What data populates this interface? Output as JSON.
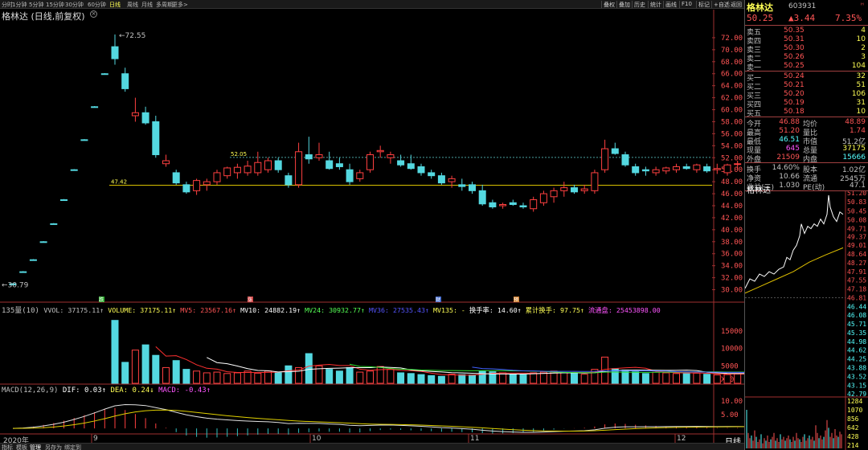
{
  "toolbar": {
    "periods": [
      "分时",
      "1分钟",
      "5分钟",
      "15分钟",
      "30分钟",
      "60分钟",
      "日线",
      "周线",
      "月线",
      "多周期",
      "更多>"
    ],
    "active_period": "日线",
    "right_buttons": [
      "叠权",
      "叠加",
      "历史",
      "统计",
      "画线",
      "F10",
      "标记",
      "+自选",
      "返回"
    ]
  },
  "chart": {
    "title": "格林达 (日线,前复权)",
    "high_marker": "72.55",
    "low_marker": "30.79",
    "line1_label": "52.05",
    "line2_label": "47.42",
    "price_axis": [
      "72.00",
      "70.00",
      "68.00",
      "66.00",
      "64.00",
      "62.00",
      "60.00",
      "58.00",
      "56.00",
      "54.00",
      "52.00",
      "50.00",
      "48.00",
      "46.00",
      "44.00",
      "42.00",
      "40.00",
      "38.00",
      "36.00",
      "34.00",
      "32.00",
      "30.00"
    ],
    "event_markers": [
      "跌",
      "涨",
      "财",
      "预"
    ],
    "vol_axis": [
      "15000",
      "10000",
      "5000",
      "X10"
    ],
    "macd_axis": [
      "10.00",
      "5.00"
    ],
    "date_labels": [
      "2020年",
      "9",
      "10",
      "11",
      "12"
    ],
    "period_label": "日线"
  },
  "volume_line": {
    "label": "135量(10)",
    "items": [
      {
        "text": "VVOL: 37175.11↑",
        "color": "#c0c0c0"
      },
      {
        "text": "VOLUME: 37175.11↑",
        "color": "#ffff55"
      },
      {
        "text": "MV5: 23567.16↑",
        "color": "#ff5555"
      },
      {
        "text": "MV10: 24882.19↑",
        "color": "#ffffff"
      },
      {
        "text": "MV24: 30932.77↑",
        "color": "#55ff55"
      },
      {
        "text": "MV36: 27535.43↑",
        "color": "#5555ff"
      },
      {
        "text": "MV135: -",
        "color": "#ffff55"
      },
      {
        "text": "换手率: 14.60↑",
        "color": "#ffffff"
      },
      {
        "text": "累计换手: 97.75↑",
        "color": "#ffff55"
      },
      {
        "text": "流通盘: 25453898.00",
        "color": "#ff55ff"
      }
    ]
  },
  "macd_line": {
    "items": [
      {
        "text": "MACD(12,26,9)",
        "color": "#c0c0c0"
      },
      {
        "text": "DIF: 0.03↑",
        "color": "#ffffff"
      },
      {
        "text": "DEA: 0.24↓",
        "color": "#ffff55"
      },
      {
        "text": "MACD: -0.43↑",
        "color": "#ff55ff"
      }
    ]
  },
  "quote": {
    "name": "格林达",
    "code": "603931",
    "price": "50.25",
    "change": "▲3.44",
    "pct": "7.35%",
    "asks": [
      {
        "label": "卖五",
        "price": "50.35",
        "vol": "4"
      },
      {
        "label": "卖四",
        "price": "50.31",
        "vol": "10"
      },
      {
        "label": "卖三",
        "price": "50.30",
        "vol": "2"
      },
      {
        "label": "卖二",
        "price": "50.26",
        "vol": "3"
      },
      {
        "label": "卖一",
        "price": "50.25",
        "vol": "104"
      }
    ],
    "bids": [
      {
        "label": "买一",
        "price": "50.24",
        "vol": "32"
      },
      {
        "label": "买二",
        "price": "50.21",
        "vol": "51"
      },
      {
        "label": "买三",
        "price": "50.20",
        "vol": "106"
      },
      {
        "label": "买四",
        "price": "50.19",
        "vol": "31"
      },
      {
        "label": "买五",
        "price": "50.18",
        "vol": "10"
      }
    ],
    "stats1": [
      {
        "l1": "今开",
        "v1": "46.88",
        "l2": "均价",
        "v2": "48.89"
      },
      {
        "l1": "最高",
        "v1": "51.20",
        "l2": "量比",
        "v2": "1.74"
      },
      {
        "l1": "最低",
        "v1": "46.51",
        "l2": "市值",
        "v2": "51.2亿"
      },
      {
        "l1": "现量",
        "v1": "645",
        "l2": "总量",
        "v2": "37175"
      },
      {
        "l1": "外盘",
        "v1": "21509",
        "l2": "内盘",
        "v2": "15666"
      }
    ],
    "stats2": [
      {
        "l1": "换手",
        "v1": "14.60%",
        "l2": "股本",
        "v2": "1.02亿"
      },
      {
        "l1": "净资",
        "v1": "10.66",
        "l2": "流通",
        "v2": "2545万"
      },
      {
        "l1": "收益(三)",
        "v1": "1.030",
        "l2": "PE(动)",
        "v2": "47.1"
      }
    ],
    "mini_title": "格林达",
    "mini_axis": [
      "51.20",
      "50.83",
      "50.45",
      "50.08",
      "49.71",
      "49.37",
      "49.01",
      "48.64",
      "48.27",
      "47.91",
      "47.55",
      "47.18",
      "46.81",
      "46.44",
      "46.08",
      "45.71",
      "45.35",
      "44.98",
      "44.62",
      "44.25",
      "43.88",
      "43.52",
      "43.15",
      "42.79"
    ],
    "mini_vol_axis": [
      "1284",
      "1070",
      "856",
      "642",
      "428",
      "214"
    ]
  },
  "bottom_tabs": [
    "指标",
    "模板",
    "管理",
    "另存为",
    "绑定到"
  ],
  "chart_data": {
    "type": "candlestick",
    "title": "格林达 (日线,前复权)",
    "candles": [
      [
        31,
        31.1,
        30.8,
        30.8
      ],
      [
        33,
        33.1,
        32.9,
        32.9
      ],
      [
        35,
        35.1,
        34.9,
        34.9
      ],
      [
        38,
        38.1,
        37.9,
        37.9
      ],
      [
        41,
        41.1,
        40.9,
        40.9
      ],
      [
        45,
        45.1,
        44.9,
        44.9
      ],
      [
        50,
        50.1,
        49.9,
        49.9
      ],
      [
        55,
        55.1,
        54.9,
        54.9
      ],
      [
        60.5,
        60.6,
        60.4,
        60.4
      ],
      [
        66,
        66.1,
        65.9,
        65.9
      ],
      [
        70.5,
        72.55,
        67.5,
        68.5
      ],
      [
        66,
        67,
        63,
        63.5
      ],
      [
        59,
        62,
        58,
        59.5
      ],
      [
        59.5,
        60.5,
        57.5,
        57.8
      ],
      [
        58,
        59,
        52,
        52.5
      ],
      [
        51,
        52.5,
        50.5,
        51.5
      ],
      [
        49.5,
        50,
        47.5,
        47.8
      ],
      [
        47.5,
        48,
        46,
        46.3
      ],
      [
        46.5,
        48.5,
        45.8,
        48.2
      ],
      [
        47.5,
        48.5,
        46.5,
        48
      ],
      [
        48,
        50,
        47.5,
        49.5
      ],
      [
        49,
        50.5,
        48.5,
        50.3
      ],
      [
        49.5,
        51,
        48.5,
        50.4
      ],
      [
        49.5,
        51.5,
        49,
        50.6
      ],
      [
        49.5,
        53,
        49,
        51.2
      ],
      [
        50,
        52,
        49.5,
        51.5
      ],
      [
        51.5,
        52,
        49.5,
        50
      ],
      [
        49,
        49.5,
        47,
        47.5
      ],
      [
        47.5,
        54.5,
        47,
        53
      ],
      [
        52.5,
        55.5,
        51,
        51.8
      ],
      [
        52,
        54.5,
        51.5,
        52.5
      ],
      [
        51.5,
        53,
        50,
        50.2
      ],
      [
        51,
        52,
        50,
        50.5
      ],
      [
        50,
        51,
        47.5,
        48
      ],
      [
        48.5,
        50,
        48,
        49.5
      ],
      [
        50,
        53,
        49.5,
        52.5
      ],
      [
        53,
        54,
        52,
        53.2
      ],
      [
        52,
        53,
        51,
        52.5
      ],
      [
        51.5,
        52.5,
        50.5,
        50.8
      ],
      [
        51,
        52.5,
        50,
        50.2
      ],
      [
        50.5,
        51,
        49,
        49.5
      ],
      [
        49.5,
        50,
        48.5,
        49
      ],
      [
        49,
        49.5,
        47.5,
        47.8
      ],
      [
        48,
        49,
        47,
        48.5
      ],
      [
        47.5,
        48.5,
        46.5,
        47.2
      ],
      [
        47.5,
        48,
        46,
        46.5
      ],
      [
        46.5,
        47.5,
        44,
        44.3
      ],
      [
        44.5,
        45,
        43.5,
        43.8
      ],
      [
        44,
        44.5,
        43.5,
        44.2
      ],
      [
        44.5,
        45,
        44,
        44.2
      ],
      [
        44,
        44.5,
        43.5,
        43.8
      ],
      [
        43.5,
        45.5,
        43,
        45
      ],
      [
        44.5,
        46.5,
        44,
        46
      ],
      [
        45.5,
        47,
        44.5,
        46.5
      ],
      [
        46.5,
        48,
        45.5,
        47
      ],
      [
        47,
        47.5,
        46,
        46.3
      ],
      [
        46.5,
        47.5,
        46,
        46.8
      ],
      [
        46.5,
        50,
        46,
        49.5
      ],
      [
        50,
        55,
        49.5,
        53.5
      ],
      [
        53.5,
        54.5,
        52.5,
        52.7
      ],
      [
        52.5,
        53,
        50.5,
        50.8
      ],
      [
        50.5,
        51,
        49,
        49.5
      ],
      [
        50,
        50.5,
        49,
        49.8
      ],
      [
        49.5,
        50.5,
        49,
        50
      ],
      [
        49.8,
        50.5,
        49.3,
        50.3
      ],
      [
        50,
        51,
        49.5,
        50.5
      ],
      [
        50.5,
        51,
        50,
        50.2
      ],
      [
        50,
        51,
        49.5,
        50.8
      ],
      [
        50.5,
        51,
        49.5,
        49.8
      ],
      [
        50,
        51,
        49.3,
        50.2
      ],
      [
        49.5,
        51,
        49,
        50.8
      ],
      [
        51,
        51.5,
        50,
        51
      ],
      [
        51,
        51.2,
        49.5,
        50
      ],
      [
        49.5,
        50,
        47.5,
        47.5
      ],
      [
        47,
        47.5,
        46,
        46.5
      ],
      [
        46.5,
        47.5,
        46,
        46.8
      ],
      [
        46.88,
        51.2,
        46.51,
        50.25
      ]
    ],
    "ylim": [
      29,
      74
    ],
    "volume": [
      0,
      0,
      0,
      0,
      0,
      0,
      0,
      0,
      0,
      0,
      18000,
      6000,
      9500,
      11000,
      8000,
      4500,
      6500,
      4000,
      3500,
      3000,
      3200,
      2800,
      3000,
      3500,
      2900,
      3500,
      3000,
      5000,
      4500,
      8500,
      5000,
      4000,
      3500,
      4500,
      3200,
      3500,
      4800,
      4000,
      3000,
      2800,
      2500,
      2200,
      2000,
      2600,
      2500,
      2400,
      3500,
      3300,
      3000,
      2500,
      2400,
      3000,
      3200,
      3500,
      3100,
      2800,
      2600,
      4000,
      7500,
      4200,
      3800,
      3300,
      2800,
      3200,
      3000,
      2800,
      3000,
      2900,
      2600,
      2400,
      2500,
      2800,
      3000,
      3200,
      2500,
      2700,
      3717
    ],
    "vol_ylim": [
      0,
      20000
    ],
    "macd_axis_range": [
      -2,
      12
    ]
  }
}
